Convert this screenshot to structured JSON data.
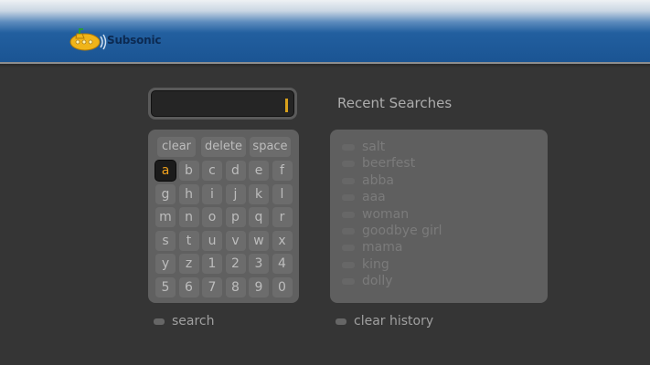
{
  "header": {
    "app_name": "Subsonic",
    "logo_icon": "submarine-logo-icon"
  },
  "search": {
    "value": ""
  },
  "keyboard": {
    "actions": [
      "clear",
      "delete",
      "space"
    ],
    "rows": [
      [
        "a",
        "b",
        "c",
        "d",
        "e",
        "f"
      ],
      [
        "g",
        "h",
        "i",
        "j",
        "k",
        "l"
      ],
      [
        "m",
        "n",
        "o",
        "p",
        "q",
        "r"
      ],
      [
        "s",
        "t",
        "u",
        "v",
        "w",
        "x"
      ],
      [
        "y",
        "z",
        "1",
        "2",
        "3",
        "4"
      ],
      [
        "5",
        "6",
        "7",
        "8",
        "9",
        "0"
      ]
    ],
    "selected": "a"
  },
  "recent": {
    "title": "Recent Searches",
    "items": [
      "salt",
      "beerfest",
      "abba",
      "aaa",
      "woman",
      "goodbye girl",
      "mama",
      "king",
      "dolly"
    ]
  },
  "footer": {
    "search_label": "search",
    "clear_history_label": "clear history"
  },
  "colors": {
    "accent": "#f0a11d",
    "header_blue": "#1b5594",
    "background": "#353535"
  }
}
